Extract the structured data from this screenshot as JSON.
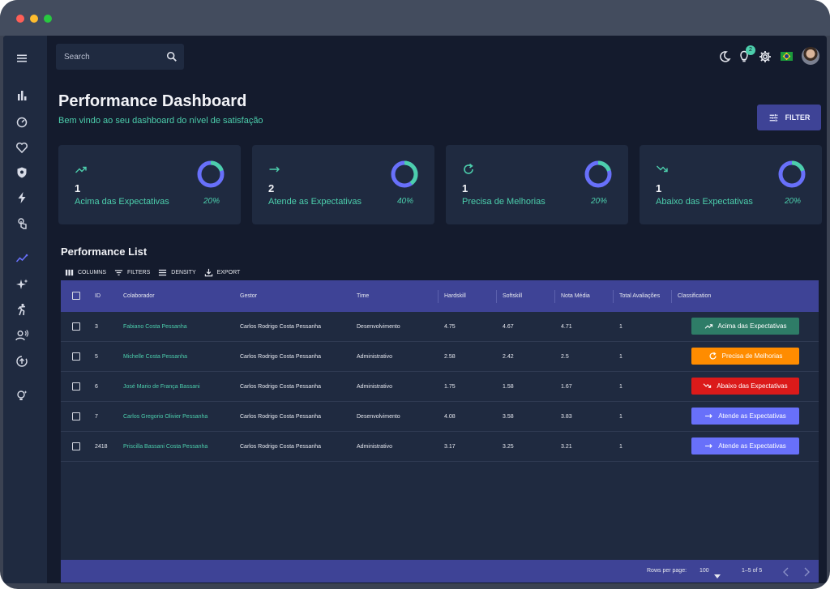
{
  "search": {
    "placeholder": "Search"
  },
  "topbar": {
    "notification_count": "2"
  },
  "header": {
    "title": "Performance Dashboard",
    "subtitle": "Bem vindo ao seu dashboard do nível de satisfação",
    "filter_label": "FILTER"
  },
  "stats": [
    {
      "icon": "trending-up-icon",
      "count": "1",
      "label": "Acima das Expectativas",
      "percent_text": "20%",
      "progress": 0.2
    },
    {
      "icon": "arrow-right-icon",
      "count": "2",
      "label": "Atende as Expectativas",
      "percent_text": "40%",
      "progress": 0.4
    },
    {
      "icon": "refresh-icon",
      "count": "1",
      "label": "Precisa de Melhorias",
      "percent_text": "20%",
      "progress": 0.2
    },
    {
      "icon": "trending-down-icon",
      "count": "1",
      "label": "Abaixo das Expectativas",
      "percent_text": "20%",
      "progress": 0.2
    }
  ],
  "list": {
    "title": "Performance List",
    "toolbar": {
      "columns": "COLUMNS",
      "filters": "FILTERS",
      "density": "DENSITY",
      "export": "EXPORT"
    },
    "columns": [
      "ID",
      "Colaborador",
      "Gestor",
      "Time",
      "Hardskill",
      "Softskill",
      "Nota Média",
      "Total Avaliações",
      "Classification"
    ],
    "rows": [
      {
        "id": "3",
        "colaborador": "Fabiano Costa Pessanha",
        "gestor": "Carlos Rodrigo Costa Pessanha",
        "time": "Desenvolvimento",
        "hardskill": "4.75",
        "softskill": "4.67",
        "nota": "4.71",
        "total": "1",
        "classification": "Acima das Expectativas"
      },
      {
        "id": "5",
        "colaborador": "Michelle Costa Pessanha",
        "gestor": "Carlos Rodrigo Costa Pessanha",
        "time": "Administrativo",
        "hardskill": "2.58",
        "softskill": "2.42",
        "nota": "2.5",
        "total": "1",
        "classification": "Precisa de Melhorias"
      },
      {
        "id": "6",
        "colaborador": "José Mario de França Bassani",
        "gestor": "Carlos Rodrigo Costa Pessanha",
        "time": "Administrativo",
        "hardskill": "1.75",
        "softskill": "1.58",
        "nota": "1.67",
        "total": "1",
        "classification": "Abaixo das Expectativas"
      },
      {
        "id": "7",
        "colaborador": "Carlos Gregorio Olivier Pessanha",
        "gestor": "Carlos Rodrigo Costa Pessanha",
        "time": "Desenvolvimento",
        "hardskill": "4.08",
        "softskill": "3.58",
        "nota": "3.83",
        "total": "1",
        "classification": "Atende as Expectativas"
      },
      {
        "id": "2418",
        "colaborador": "Priscilla Bassani Costa Pessanha",
        "gestor": "Carlos Rodrigo Costa Pessanha",
        "time": "Administrativo",
        "hardskill": "3.17",
        "softskill": "3.25",
        "nota": "3.21",
        "total": "1",
        "classification": "Atende as Expectativas"
      }
    ],
    "footer": {
      "rows_per_page_label": "Rows per page:",
      "rows_per_page_value": "100",
      "range": "1–5 of 5"
    }
  },
  "colors": {
    "background": "#141b2d",
    "panel": "#1f2a40",
    "primary": "#3e4396",
    "accent_green": "#4cceac",
    "ring_blue": "#6870fa",
    "acima": "#2e7c67",
    "precisa": "#ff8c00",
    "abaixo": "#db1a1a",
    "atende": "#6870fa"
  }
}
